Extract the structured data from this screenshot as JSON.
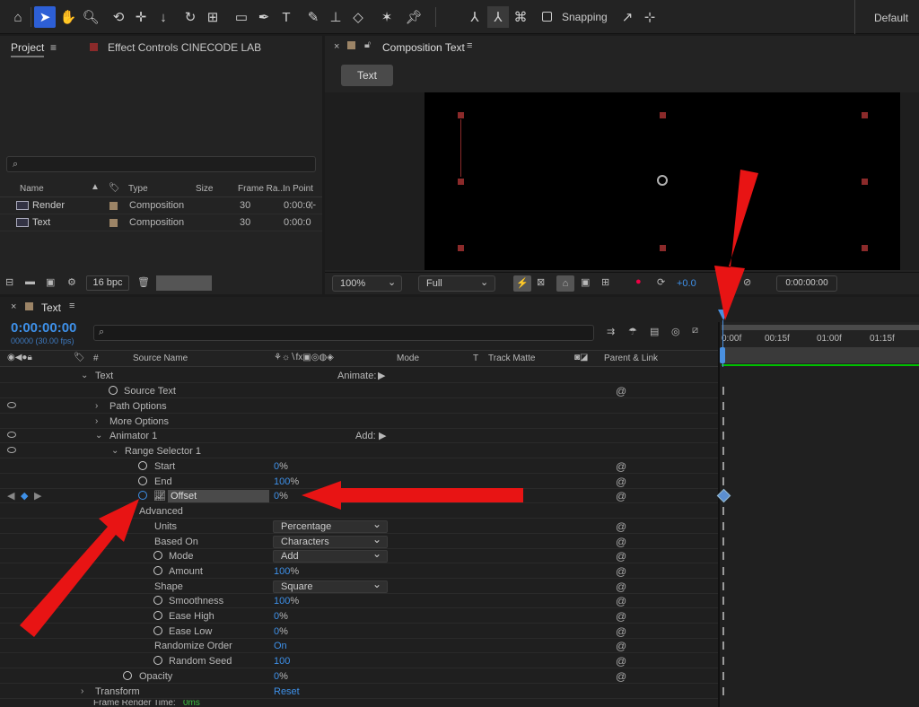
{
  "toolbar": {
    "snapping": "Snapping",
    "workspace": "Default"
  },
  "project": {
    "tab": "Project",
    "effect_tab": "Effect Controls CINECODE LAB",
    "search_placeholder": "",
    "headers": {
      "name": "Name",
      "type": "Type",
      "size": "Size",
      "frame_rate": "Frame Ra...",
      "in_point": "In Point"
    },
    "items": [
      {
        "name": "Render",
        "type": "Composition",
        "frame_rate": "30",
        "in_point": "0:00:0"
      },
      {
        "name": "Text",
        "type": "Composition",
        "frame_rate": "30",
        "in_point": "0:00:0"
      }
    ],
    "bpc": "16 bpc"
  },
  "composition": {
    "tab": "Composition Text",
    "breadcrumb": "Text",
    "zoom": "100%",
    "resolution": "Full",
    "exposure": "+0.0",
    "timecode": "0:00:00:00"
  },
  "timeline": {
    "tab": "Text",
    "timecode": "0:00:00:00",
    "fps": "00000 (30.00 fps)",
    "headers": {
      "hash": "#",
      "source_name": "Source Name",
      "mode": "Mode",
      "t": "T",
      "track_matte": "Track Matte",
      "parent": "Parent & Link"
    },
    "ruler": [
      "0:00f",
      "00:15f",
      "01:00f",
      "01:15f"
    ],
    "layers": {
      "text": "Text",
      "animate": "Animate:",
      "source_text": "Source Text",
      "path_options": "Path Options",
      "more_options": "More Options",
      "animator": "Animator 1",
      "add": "Add:",
      "range_selector": "Range Selector 1",
      "start": "Start",
      "start_val": "0",
      "end": "End",
      "end_val": "100",
      "offset": "Offset",
      "offset_val": "0",
      "advanced": "Advanced",
      "units": "Units",
      "units_val": "Percentage",
      "based_on": "Based On",
      "based_on_val": "Characters",
      "mode": "Mode",
      "mode_val": "Add",
      "amount": "Amount",
      "amount_val": "100",
      "shape": "Shape",
      "shape_val": "Square",
      "smoothness": "Smoothness",
      "smoothness_val": "100",
      "ease_high": "Ease High",
      "ease_high_val": "0",
      "ease_low": "Ease Low",
      "ease_low_val": "0",
      "randomize": "Randomize Order",
      "randomize_val": "On",
      "random_seed": "Random Seed",
      "random_seed_val": "100",
      "opacity": "Opacity",
      "opacity_val": "0",
      "transform": "Transform",
      "reset": "Reset",
      "pct": "%"
    },
    "footer": "Frame Render Time:",
    "footer_val": "0ms"
  },
  "colors": {
    "accent": "#2d5fd6",
    "arrow": "#e81414",
    "timecode": "#3e90e8",
    "green": "#00c000"
  }
}
